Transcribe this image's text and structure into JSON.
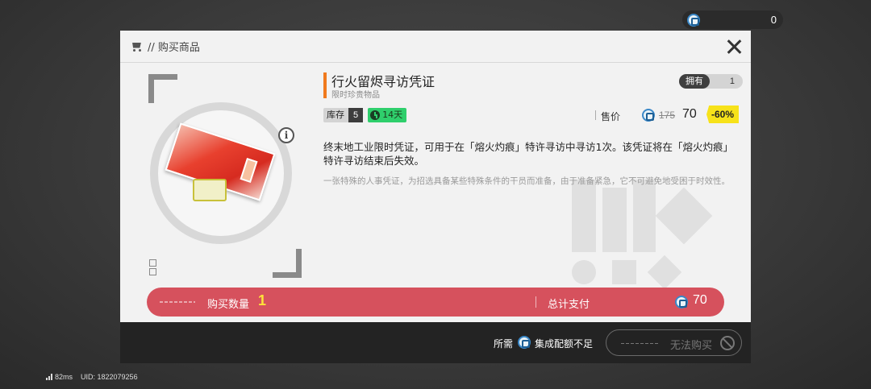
{
  "top_bar": {
    "currency_icon": "quota-coin-icon",
    "currency_value": "0"
  },
  "modal": {
    "title": "// 购买商品",
    "header_icon": "cart-icon",
    "close_icon": "close-icon"
  },
  "item": {
    "name": "行火留烬寻访凭证",
    "subtitle": "限时珍贵物品",
    "owned_label": "拥有",
    "owned_value": "1",
    "stock_label": "库存",
    "stock_value": "5",
    "time_left": "14天",
    "price_label": "售价",
    "original_price": "175",
    "price": "70",
    "discount": "-60%",
    "description": "终末地工业限时凭证，可用于在「熔火灼痕」特许寻访中寻访1次。该凭证将在「熔火灼痕」特许寻访结束后失效。",
    "flavor_text": "一张特殊的人事凭证，为招选具备某些特殊条件的干员而准备，由于准备紧急，它不可避免地受困于时效性。"
  },
  "purchase": {
    "quantity_label": "购买数量",
    "quantity": "1",
    "total_label": "总计支付",
    "total": "70"
  },
  "footer": {
    "requirement_prefix": "所需",
    "requirement_text": "集成配额不足",
    "buy_button": "无法购买"
  },
  "status": {
    "ping": "82ms",
    "uid": "UID: 1822079256"
  },
  "colors": {
    "accent_orange": "#f07a1e",
    "quantity_bar": "#d6515d",
    "discount_yellow": "#f7e21a",
    "timer_green": "#2fcf6c"
  }
}
